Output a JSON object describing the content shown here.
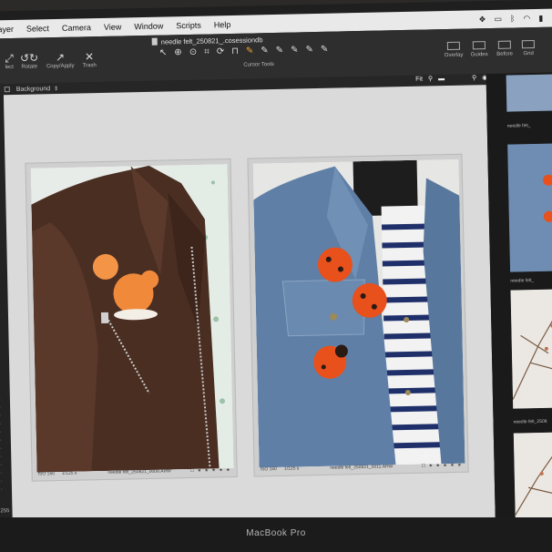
{
  "menubar": {
    "items": [
      "Layer",
      "Select",
      "Camera",
      "View",
      "Window",
      "Scripts",
      "Help"
    ],
    "status_icons": [
      "dropbox-icon",
      "display-icon",
      "bluetooth-icon",
      "wifi-icon",
      "battery-icon"
    ]
  },
  "toolbar": {
    "document_title": "needle felt_250821_.cosessiondb",
    "buttons": [
      {
        "label": "lect",
        "icon": "select-icon",
        "glyph": "⤢"
      },
      {
        "label": "Rotate",
        "icon": "rotate-icon",
        "glyph": "↺↻"
      },
      {
        "label": "Copy/Apply",
        "icon": "copy-apply-icon",
        "glyph": "↗"
      },
      {
        "label": "Trash",
        "icon": "trash-icon",
        "glyph": "✕"
      }
    ],
    "cursor_tools_label": "Cursor Tools",
    "cursor_tools": [
      "↖",
      "⊕",
      "⊙",
      "⌗",
      "⟳",
      "⊓",
      "✎",
      "✎",
      "✎",
      "✎",
      "✎",
      "✎"
    ],
    "right_buttons": [
      "Overlay",
      "Guides",
      "Before",
      "Grid"
    ]
  },
  "subbar": {
    "layer_name": "Background",
    "fit_label": "Fit"
  },
  "viewer": {
    "photos": [
      {
        "caption_iso": "ISO 160",
        "caption_shutter": "1/125 s",
        "caption_file": "needle felt_250821_0008.ARW",
        "stars": "☐ ★ ★ ★ ★ ★"
      },
      {
        "caption_iso": "ISO 160",
        "caption_shutter": "1/125 s",
        "caption_file": "needle felt_250821_0011.ARW",
        "stars": "☐ ★ ★ ★ ★ ★"
      }
    ]
  },
  "filmstrip": {
    "labels": [
      "needle felt_",
      "needle felt_",
      "needle felt_2508"
    ]
  },
  "left_strip": {
    "zoom": "255"
  },
  "bezel": {
    "brand": "MacBook Pro"
  },
  "colors": {
    "viewer_bg": "#dadada",
    "ladybug": "#e8501c",
    "squirrel": "#f08a3a",
    "denim": "#5f7fa6",
    "leather": "#4a2e22"
  }
}
